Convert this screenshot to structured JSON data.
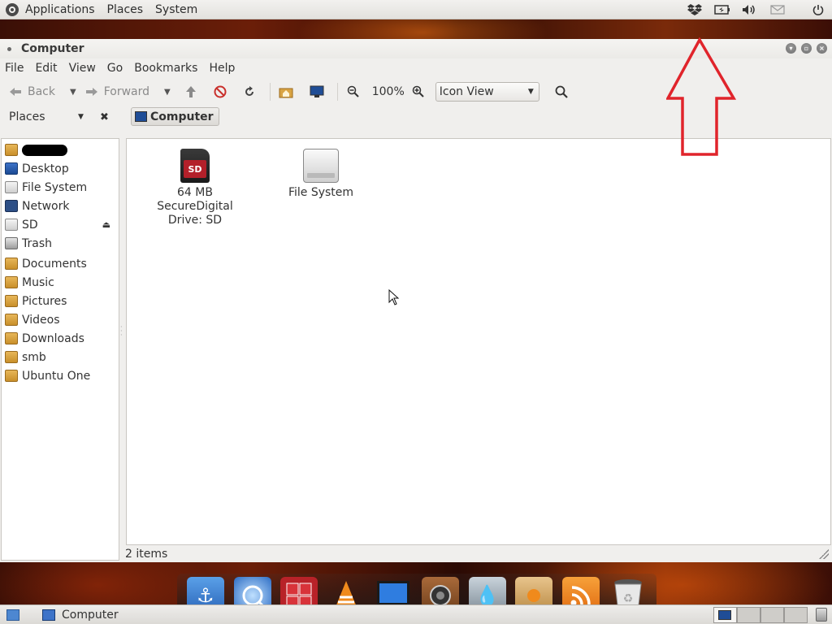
{
  "top_panel": {
    "menus": [
      "Applications",
      "Places",
      "System"
    ]
  },
  "window": {
    "title": "Computer",
    "menubar": [
      "File",
      "Edit",
      "View",
      "Go",
      "Bookmarks",
      "Help"
    ],
    "toolbar": {
      "back_label": "Back",
      "forward_label": "Forward",
      "zoom_level": "100%",
      "view_mode": "Icon View"
    },
    "sidebar": {
      "header": "Places",
      "items": [
        {
          "label": "",
          "icon": "home-folder-icon"
        },
        {
          "label": "Desktop",
          "icon": "desktop-icon"
        },
        {
          "label": "File System",
          "icon": "drive-icon"
        },
        {
          "label": "Network",
          "icon": "network-icon"
        },
        {
          "label": "SD",
          "icon": "drive-icon"
        },
        {
          "label": "Trash",
          "icon": "trash-icon"
        }
      ],
      "bookmarks": [
        {
          "label": "Documents",
          "icon": "folder-icon"
        },
        {
          "label": "Music",
          "icon": "folder-icon"
        },
        {
          "label": "Pictures",
          "icon": "folder-icon"
        },
        {
          "label": "Videos",
          "icon": "folder-icon"
        },
        {
          "label": "Downloads",
          "icon": "folder-icon"
        },
        {
          "label": "smb",
          "icon": "folder-icon"
        },
        {
          "label": "Ubuntu One",
          "icon": "folder-icon"
        }
      ]
    },
    "pathbar": {
      "crumb": "Computer"
    },
    "files": [
      {
        "label_lines": [
          "64 MB",
          "SecureDigital",
          "Drive: SD"
        ],
        "icon": "sd-card-icon",
        "badge": "SD"
      },
      {
        "label_lines": [
          "File System"
        ],
        "icon": "hard-drive-icon"
      }
    ],
    "status": "2 items"
  },
  "taskbar": {
    "task_label": "Computer"
  },
  "colors": {
    "annotation_arrow": "#e0242b",
    "selection": "#3d73c8"
  }
}
